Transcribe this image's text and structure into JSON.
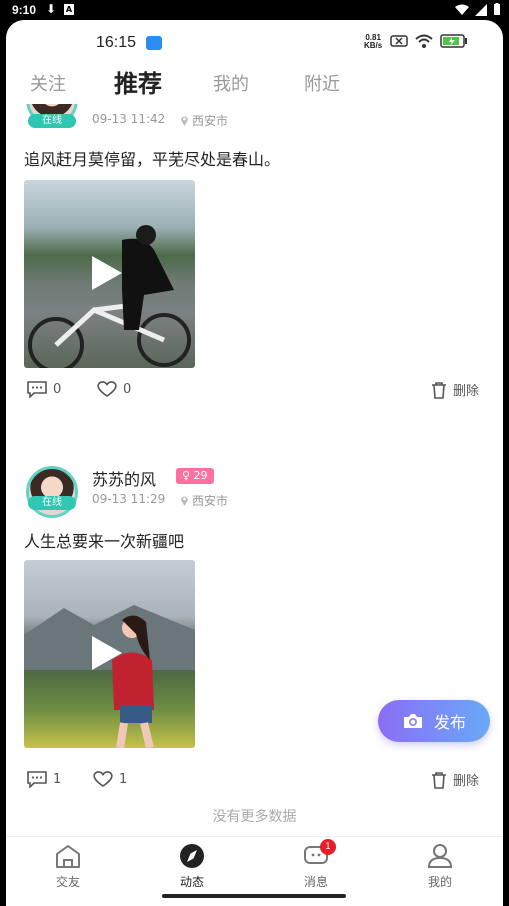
{
  "system_status": {
    "time": "9:10"
  },
  "inner_status": {
    "time": "16:15",
    "speed_value": "0.81",
    "speed_unit": "KB/s"
  },
  "tabs": [
    {
      "label": "关注",
      "active": false
    },
    {
      "label": "推荐",
      "active": true
    },
    {
      "label": "我的",
      "active": false
    },
    {
      "label": "附近",
      "active": false
    }
  ],
  "posts": [
    {
      "online_label": "在线",
      "datetime": "09-13 11:42",
      "location": "西安市",
      "text": "追风赶月莫停留，平芜尽处是春山。",
      "comments": "0",
      "likes": "0",
      "delete_label": "删除"
    },
    {
      "username": "苏苏的风",
      "gender_age": "♀ 29",
      "online_label": "在线",
      "datetime": "09-13 11:29",
      "location": "西安市",
      "text": "人生总要来一次新疆吧",
      "comments": "1",
      "likes": "1",
      "delete_label": "删除"
    }
  ],
  "end_text": "没有更多数据",
  "fab": {
    "label": "发布",
    "icon": "camera-icon"
  },
  "bottom_nav": [
    {
      "label": "交友",
      "icon": "home-icon",
      "active": false
    },
    {
      "label": "动态",
      "icon": "compass-icon",
      "active": true
    },
    {
      "label": "消息",
      "icon": "message-icon",
      "active": false,
      "badge": "1"
    },
    {
      "label": "我的",
      "icon": "user-icon",
      "active": false
    }
  ],
  "colors": {
    "accent_teal": "#2fc7b1",
    "badge_pink": "#ff6fa0",
    "fab_gradient_start": "#8b6df6",
    "fab_gradient_end": "#6aa9f7",
    "notification_red": "#e81f2b"
  }
}
